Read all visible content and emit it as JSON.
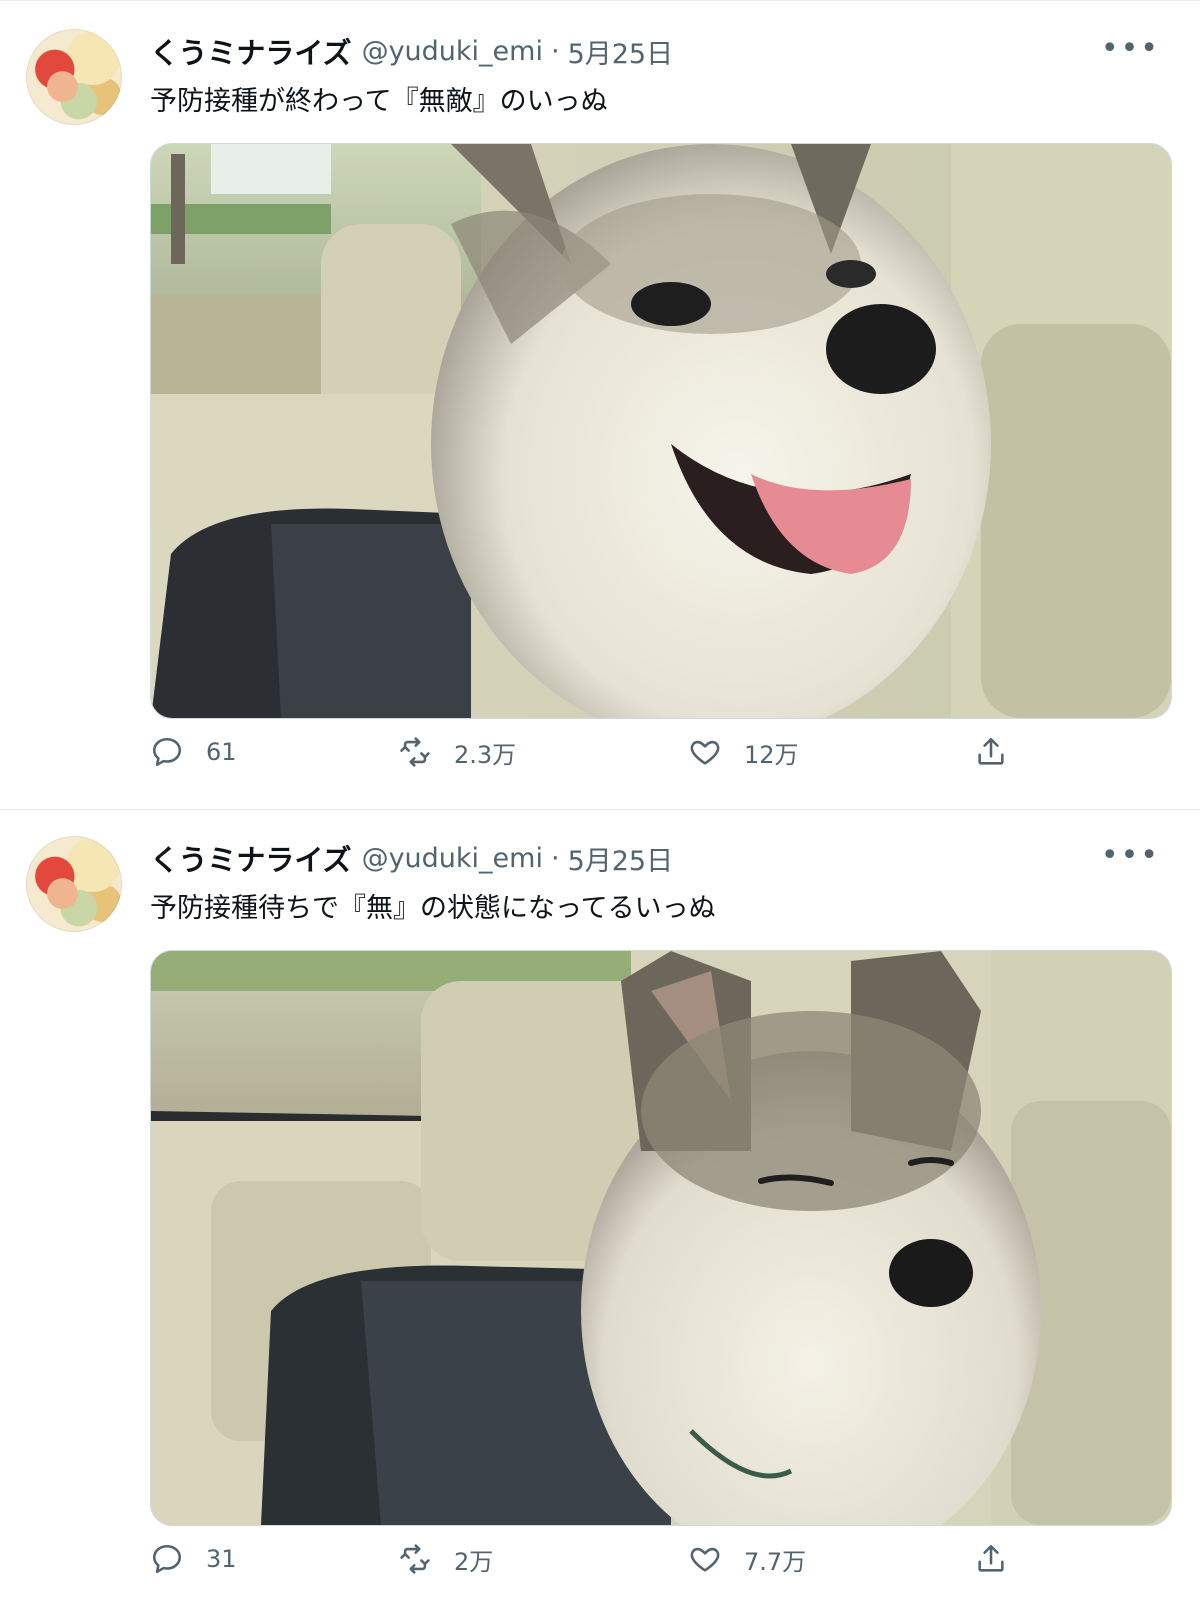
{
  "tweets": [
    {
      "display_name": "くうミナライズ",
      "handle": "@yuduki_emi",
      "separator": "·",
      "date": "5月25日",
      "text": "予防接種が終わって『無敵』のいっぬ",
      "replies": "61",
      "retweets": "2.3万",
      "likes": "12万"
    },
    {
      "display_name": "くうミナライズ",
      "handle": "@yuduki_emi",
      "separator": "·",
      "date": "5月25日",
      "text": "予防接種待ちで『無』の状態になってるいっぬ",
      "replies": "31",
      "retweets": "2万",
      "likes": "7.7万"
    }
  ],
  "icons": {
    "more": "more-horizontal-icon",
    "reply": "reply-bubble-icon",
    "retweet": "retweet-icon",
    "like": "heart-icon",
    "share": "share-upload-icon"
  },
  "colors": {
    "text_primary": "#0f1419",
    "text_secondary": "#536471",
    "divider": "#e1e8ed"
  }
}
